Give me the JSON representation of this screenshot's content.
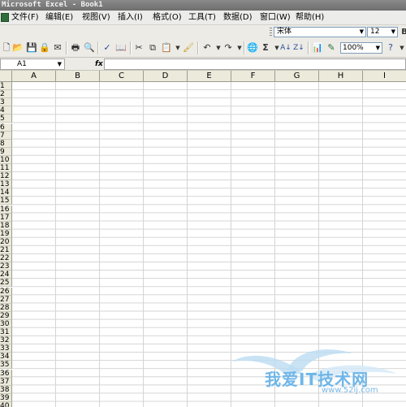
{
  "window": {
    "title": "Microsoft Excel - Book1"
  },
  "menu": {
    "items": [
      "文件(F)",
      "编辑(E)",
      "视图(V)",
      "插入(I)",
      "格式(O)",
      "工具(T)",
      "数据(D)",
      "窗口(W)",
      "帮助(H)"
    ]
  },
  "format_toolbar": {
    "font_name": "宋体",
    "font_size": "12"
  },
  "standard_toolbar": {
    "sum_symbol": "Σ",
    "zoom": "100%"
  },
  "formula_bar": {
    "cell_ref": "A1",
    "fx_label": "fx",
    "formula": ""
  },
  "sheet": {
    "columns": [
      "A",
      "B",
      "C",
      "D",
      "E",
      "F",
      "G",
      "H",
      "I"
    ],
    "rows": [
      "1",
      "2",
      "3",
      "4",
      "5",
      "6",
      "7",
      "8",
      "9",
      "10",
      "11",
      "12",
      "13",
      "14",
      "15",
      "16",
      "17",
      "18",
      "19",
      "20",
      "21",
      "22",
      "23",
      "24",
      "25",
      "26",
      "27",
      "28",
      "29",
      "30",
      "31",
      "32",
      "33",
      "34",
      "35",
      "36",
      "37",
      "38",
      "39",
      "40"
    ]
  },
  "watermark": {
    "text": "我爱IT技术网",
    "url": "www.52ij.com"
  },
  "colors": {
    "titlebar": "#7a7a7a",
    "toolbar": "#ecebe6",
    "header": "#ebeadb",
    "gridline": "#d4d4d4",
    "watermark": "#6fb6e8"
  }
}
